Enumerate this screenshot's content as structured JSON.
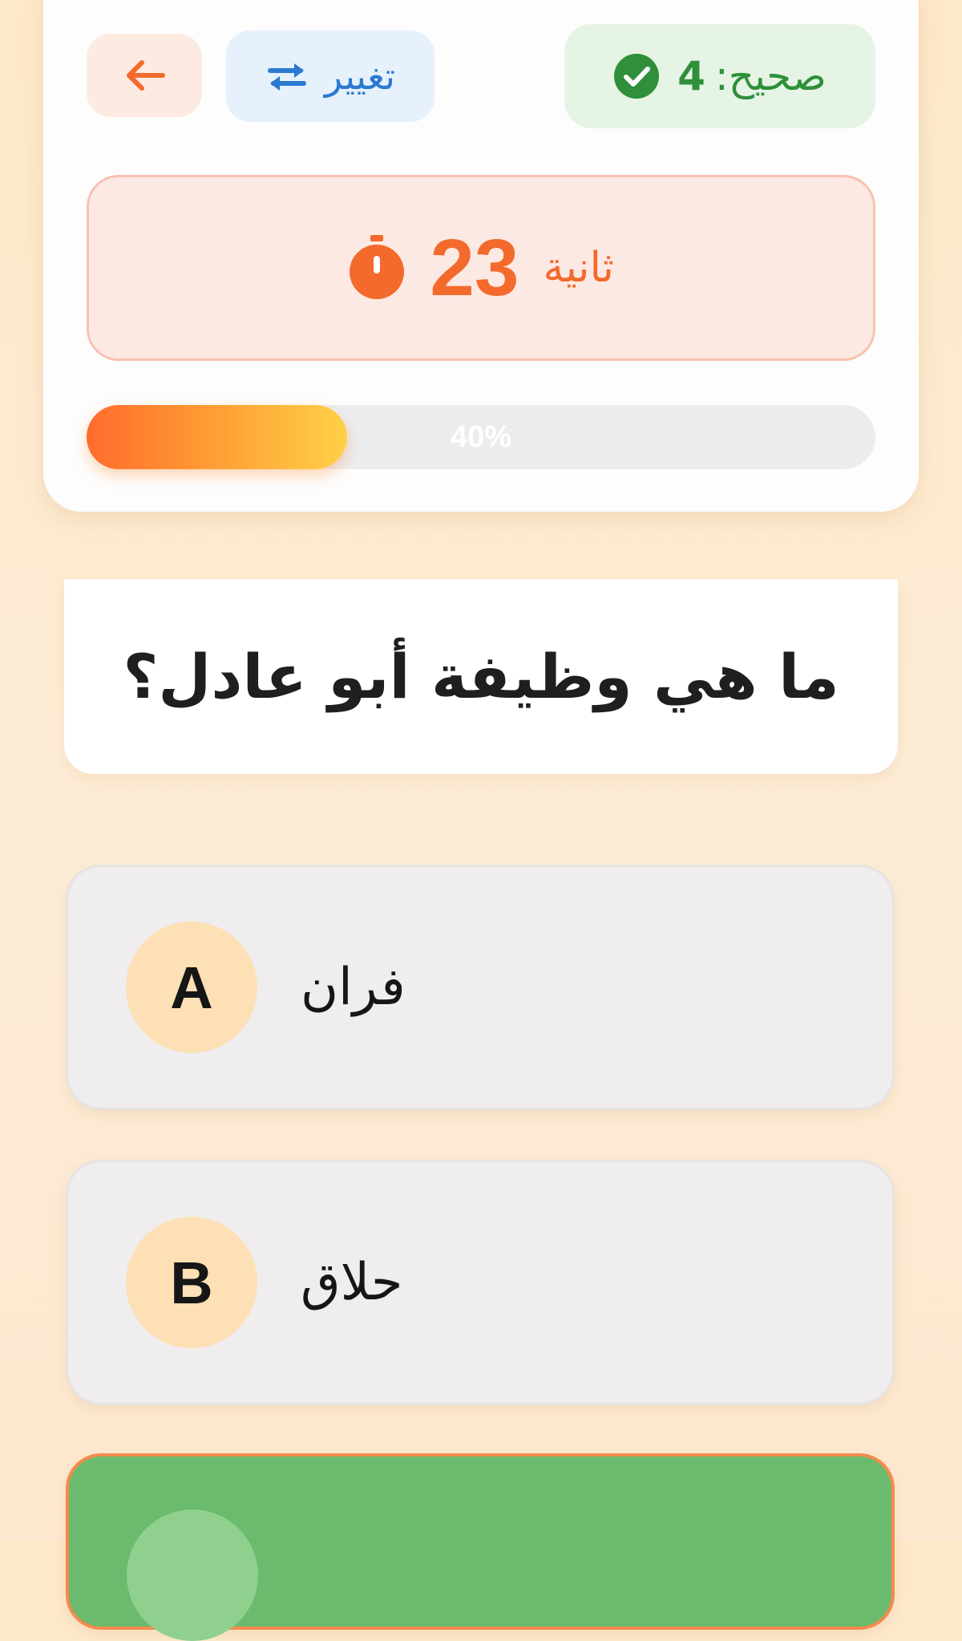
{
  "header": {
    "back_icon": "arrow-left-icon",
    "change_label": "تغيير",
    "change_icon": "swap-arrows-icon",
    "score_label": "صحيح:",
    "score_value": "4",
    "score_icon": "check-circle-icon",
    "timer_icon": "stopwatch-icon",
    "timer_value": "23",
    "timer_unit": "ثانية",
    "progress_label": "40%",
    "progress_fraction": 0.33
  },
  "question": {
    "text": "ما هي وظيفة أبو عادل؟"
  },
  "answers": [
    {
      "letter": "A",
      "label": "فران"
    },
    {
      "letter": "B",
      "label": "حلاق"
    },
    {
      "letter": "",
      "label": ""
    }
  ],
  "colors": {
    "accent_orange": "#f36a2c",
    "correct_green": "#2f8f3a",
    "change_blue": "#2a7ad0",
    "highlight_answer": "#6bbb6e"
  }
}
